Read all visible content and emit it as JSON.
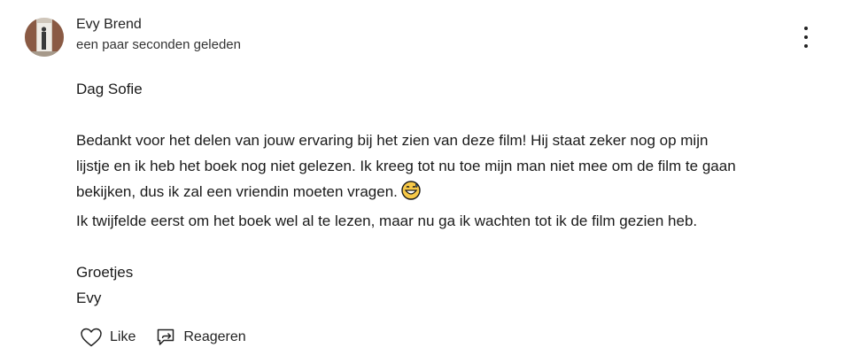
{
  "comment": {
    "author": "Evy Brend",
    "timestamp": "een paar seconden geleden",
    "greeting": "Dag Sofie",
    "paragraph_1_line_1": "Bedankt voor het delen van jouw ervaring bij het zien van deze film! Hij staat zeker nog op mijn",
    "paragraph_1_line_2": "lijstje en ik heb het boek nog niet gelezen. Ik kreeg tot nu toe mijn man niet mee om de film te gaan",
    "paragraph_1_line_3": "bekijken, dus ik zal een vriendin moeten vragen.",
    "paragraph_2": "Ik twijfelde eerst om het boek wel al te lezen, maar nu ga ik wachten tot ik de film gezien heb.",
    "closing": "Groetjes",
    "signature": "Evy"
  },
  "actions": {
    "like_label": "Like",
    "reply_label": "Reageren"
  },
  "icons": {
    "more": "more-vertical-icon",
    "like": "heart-outline-icon",
    "reply": "reply-icon",
    "emoji": "grinning-sweat-emoji"
  },
  "colors": {
    "text": "#1a1a1a",
    "emoji_face": "#f7c948"
  }
}
